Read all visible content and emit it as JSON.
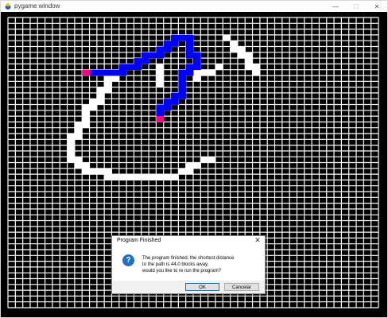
{
  "window": {
    "title": "pygame window",
    "controls": {
      "minimize": "—",
      "maximize": "☐",
      "close": "✕"
    }
  },
  "grid": {
    "cols": 50,
    "rows": 50,
    "background_color": "#000000",
    "gridline_color": "#ffffff",
    "colors": {
      "wall": "#ffffff",
      "path": "#0000ff",
      "endpoint": "#ff0080"
    },
    "cells": {
      "wall": [
        [
          29,
          3
        ],
        [
          30,
          4
        ],
        [
          30,
          5
        ],
        [
          31,
          5
        ],
        [
          31,
          6
        ],
        [
          32,
          6
        ],
        [
          32,
          7
        ],
        [
          32,
          8
        ],
        [
          33,
          8
        ],
        [
          33,
          9
        ],
        [
          28,
          8
        ],
        [
          27,
          9
        ],
        [
          26,
          9
        ],
        [
          25,
          9
        ],
        [
          25,
          10
        ],
        [
          20,
          8
        ],
        [
          20,
          9
        ],
        [
          20,
          10
        ],
        [
          20,
          11
        ],
        [
          14,
          9
        ],
        [
          14,
          10
        ],
        [
          13,
          10
        ],
        [
          13,
          11
        ],
        [
          13,
          12
        ],
        [
          12,
          12
        ],
        [
          12,
          13
        ],
        [
          12,
          14
        ],
        [
          11,
          14
        ],
        [
          11,
          15
        ],
        [
          10,
          15
        ],
        [
          10,
          16
        ],
        [
          10,
          17
        ],
        [
          10,
          18
        ],
        [
          9,
          18
        ],
        [
          9,
          19
        ],
        [
          9,
          20
        ],
        [
          8,
          20
        ],
        [
          8,
          21
        ],
        [
          8,
          22
        ],
        [
          8,
          23
        ],
        [
          8,
          24
        ],
        [
          9,
          24
        ],
        [
          9,
          25
        ],
        [
          10,
          25
        ],
        [
          10,
          26
        ],
        [
          11,
          26
        ],
        [
          12,
          26
        ],
        [
          13,
          26
        ],
        [
          13,
          27
        ],
        [
          14,
          27
        ],
        [
          15,
          27
        ],
        [
          16,
          27
        ],
        [
          17,
          27
        ],
        [
          18,
          27
        ],
        [
          19,
          27
        ],
        [
          20,
          27
        ],
        [
          21,
          27
        ],
        [
          22,
          27
        ],
        [
          23,
          26
        ],
        [
          24,
          26
        ],
        [
          24,
          25
        ],
        [
          25,
          25
        ],
        [
          26,
          24
        ],
        [
          27,
          24
        ]
      ],
      "path": [
        [
          11,
          9
        ],
        [
          12,
          9
        ],
        [
          13,
          9
        ],
        [
          14,
          9
        ],
        [
          15,
          9
        ],
        [
          15,
          8
        ],
        [
          16,
          8
        ],
        [
          17,
          8
        ],
        [
          17,
          7
        ],
        [
          18,
          7
        ],
        [
          18,
          6
        ],
        [
          19,
          6
        ],
        [
          20,
          6
        ],
        [
          20,
          5
        ],
        [
          21,
          5
        ],
        [
          21,
          4
        ],
        [
          22,
          4
        ],
        [
          22,
          3
        ],
        [
          23,
          3
        ],
        [
          24,
          3
        ],
        [
          24,
          4
        ],
        [
          24,
          5
        ],
        [
          24,
          6
        ],
        [
          25,
          6
        ],
        [
          25,
          7
        ],
        [
          25,
          8
        ],
        [
          24,
          8
        ],
        [
          24,
          9
        ],
        [
          23,
          9
        ],
        [
          23,
          10
        ],
        [
          23,
          11
        ],
        [
          23,
          12
        ],
        [
          23,
          13
        ],
        [
          22,
          13
        ],
        [
          22,
          14
        ],
        [
          21,
          14
        ],
        [
          21,
          15
        ],
        [
          20,
          15
        ],
        [
          20,
          16
        ]
      ],
      "endpoints": [
        [
          10,
          9
        ],
        [
          20,
          17
        ]
      ]
    }
  },
  "dialog": {
    "title": "Program Finished",
    "close": "✕",
    "icon": "?",
    "message_lines": [
      "The program finished, the shortest distance",
      "to the path is 44.0 blocks away,",
      "would you like to re run the program?"
    ],
    "ok_label": "OK",
    "cancel_label": "Cancelar"
  }
}
